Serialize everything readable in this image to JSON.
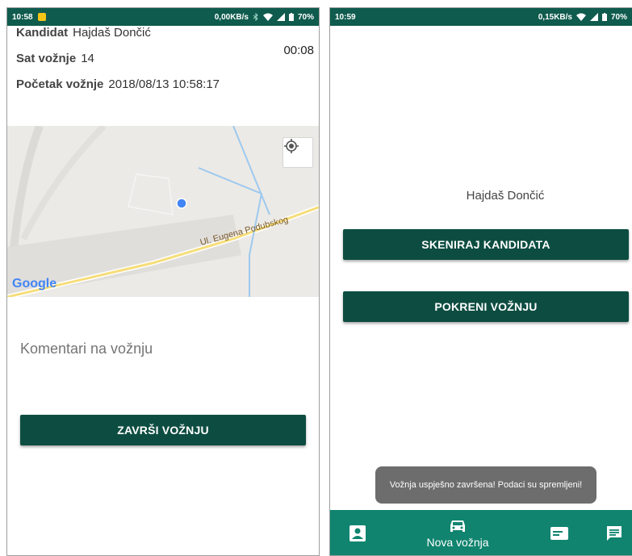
{
  "screen1": {
    "status": {
      "time": "10:58",
      "net_speed": "0,00KB/s",
      "battery": "70%"
    },
    "candidate_label": "Kandidat",
    "candidate_value": "Hajdaš Dončić",
    "hour_label": "Sat vožnje",
    "hour_value": "14",
    "timer": "00:08",
    "start_label": "Početak vožnje",
    "start_value": "2018/08/13 10:58:17",
    "map": {
      "street_label": "Ul. Eugena Podubskog",
      "provider": "Google"
    },
    "comment_placeholder": "Komentari na vožnju",
    "finish_button": "ZAVRŠI VOŽNJU"
  },
  "screen2": {
    "status": {
      "time": "10:59",
      "net_speed": "0,15KB/s",
      "battery": "70%"
    },
    "candidate_name": "Hajdaš Dončić",
    "scan_button": "SKENIRAJ KANDIDATA",
    "start_button": "POKRENI VOŽNJU",
    "toast": "Vožnja uspješno završena! Podaci su spremljeni!",
    "nav": {
      "items": [
        "profile-icon",
        "car-icon",
        "card-icon",
        "message-icon"
      ],
      "new_ride_label": "Nova vožnja"
    }
  },
  "colors": {
    "status_bar": "#0f5b4e",
    "button": "#0d4d41",
    "bottom_nav": "#10846f",
    "toast": "#6d6d6d"
  }
}
